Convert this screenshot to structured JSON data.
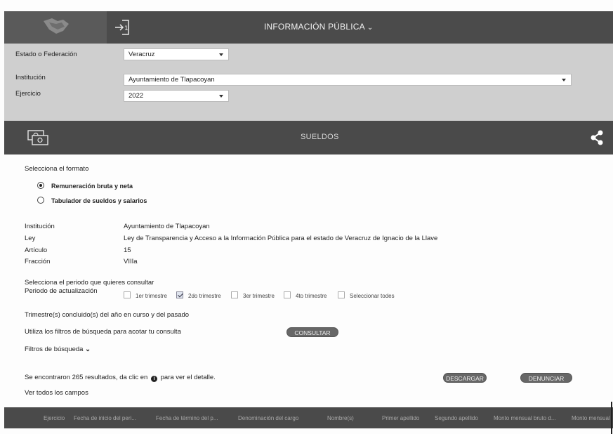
{
  "header": {
    "title": "INFORMACIÓN PÚBLICA",
    "chevron": "⌄"
  },
  "filters": {
    "estado_label": "Estado o Federación",
    "estado_value": "Veracruz",
    "institucion_label": "Institución",
    "institucion_value": "Ayuntamiento de Tlapacoyan",
    "ejercicio_label": "Ejercicio",
    "ejercicio_value": "2022"
  },
  "section": {
    "title": "SUELDOS"
  },
  "format": {
    "label": "Selecciona el formato",
    "options": [
      "Remuneración bruta y neta",
      "Tabulador de sueldos y salarios"
    ],
    "selected": 0
  },
  "details": {
    "rows": [
      {
        "key": "Institución",
        "value": "Ayuntamiento de Tlapacoyan"
      },
      {
        "key": "Ley",
        "value": "Ley de Transparencia y Acceso a la Información Pública para el estado de Veracruz de Ignacio de la Llave"
      },
      {
        "key": "Artículo",
        "value": "15"
      },
      {
        "key": "Fracción",
        "value": "VIIIa"
      }
    ]
  },
  "periodo": {
    "prompt": "Selecciona el periodo que quieres consultar",
    "label": "Periodo de actualización",
    "options": [
      "1er trimestre",
      "2do trimestre",
      "3er trimestre",
      "4to trimestre",
      "Seleccionar todes"
    ],
    "checked": [
      false,
      true,
      false,
      false,
      false
    ],
    "note": "Trimestre(s) concluido(s) del año en curso y del pasado"
  },
  "consulta": {
    "text": "Utiliza los filtros de búsqueda para acotar tu consulta",
    "button": "CONSULTAR",
    "filtros": "Filtros de búsqueda",
    "filtros_chevron": "⌄"
  },
  "results": {
    "text_before": "Se encontraron 265 resultados, da clic en",
    "info_glyph": "i",
    "text_after": "para ver el detalle.",
    "download": "DESCARGAR",
    "report": "DENUNCIAR",
    "ver_todos": "Ver todos los campos"
  },
  "table": {
    "columns": [
      "Ejercicio",
      "Fecha de inicio del peri...",
      "Fecha de término del p...",
      "Denominación del cargo",
      "Nombre(s)",
      "Primer apellido",
      "Segundo apellido",
      "Monto mensual bruto d...",
      "Monto mensual"
    ]
  },
  "colors": {
    "dark_bar": "#4a4a4a",
    "filter_panel": "#cfcfcf",
    "pill": "#676767"
  }
}
